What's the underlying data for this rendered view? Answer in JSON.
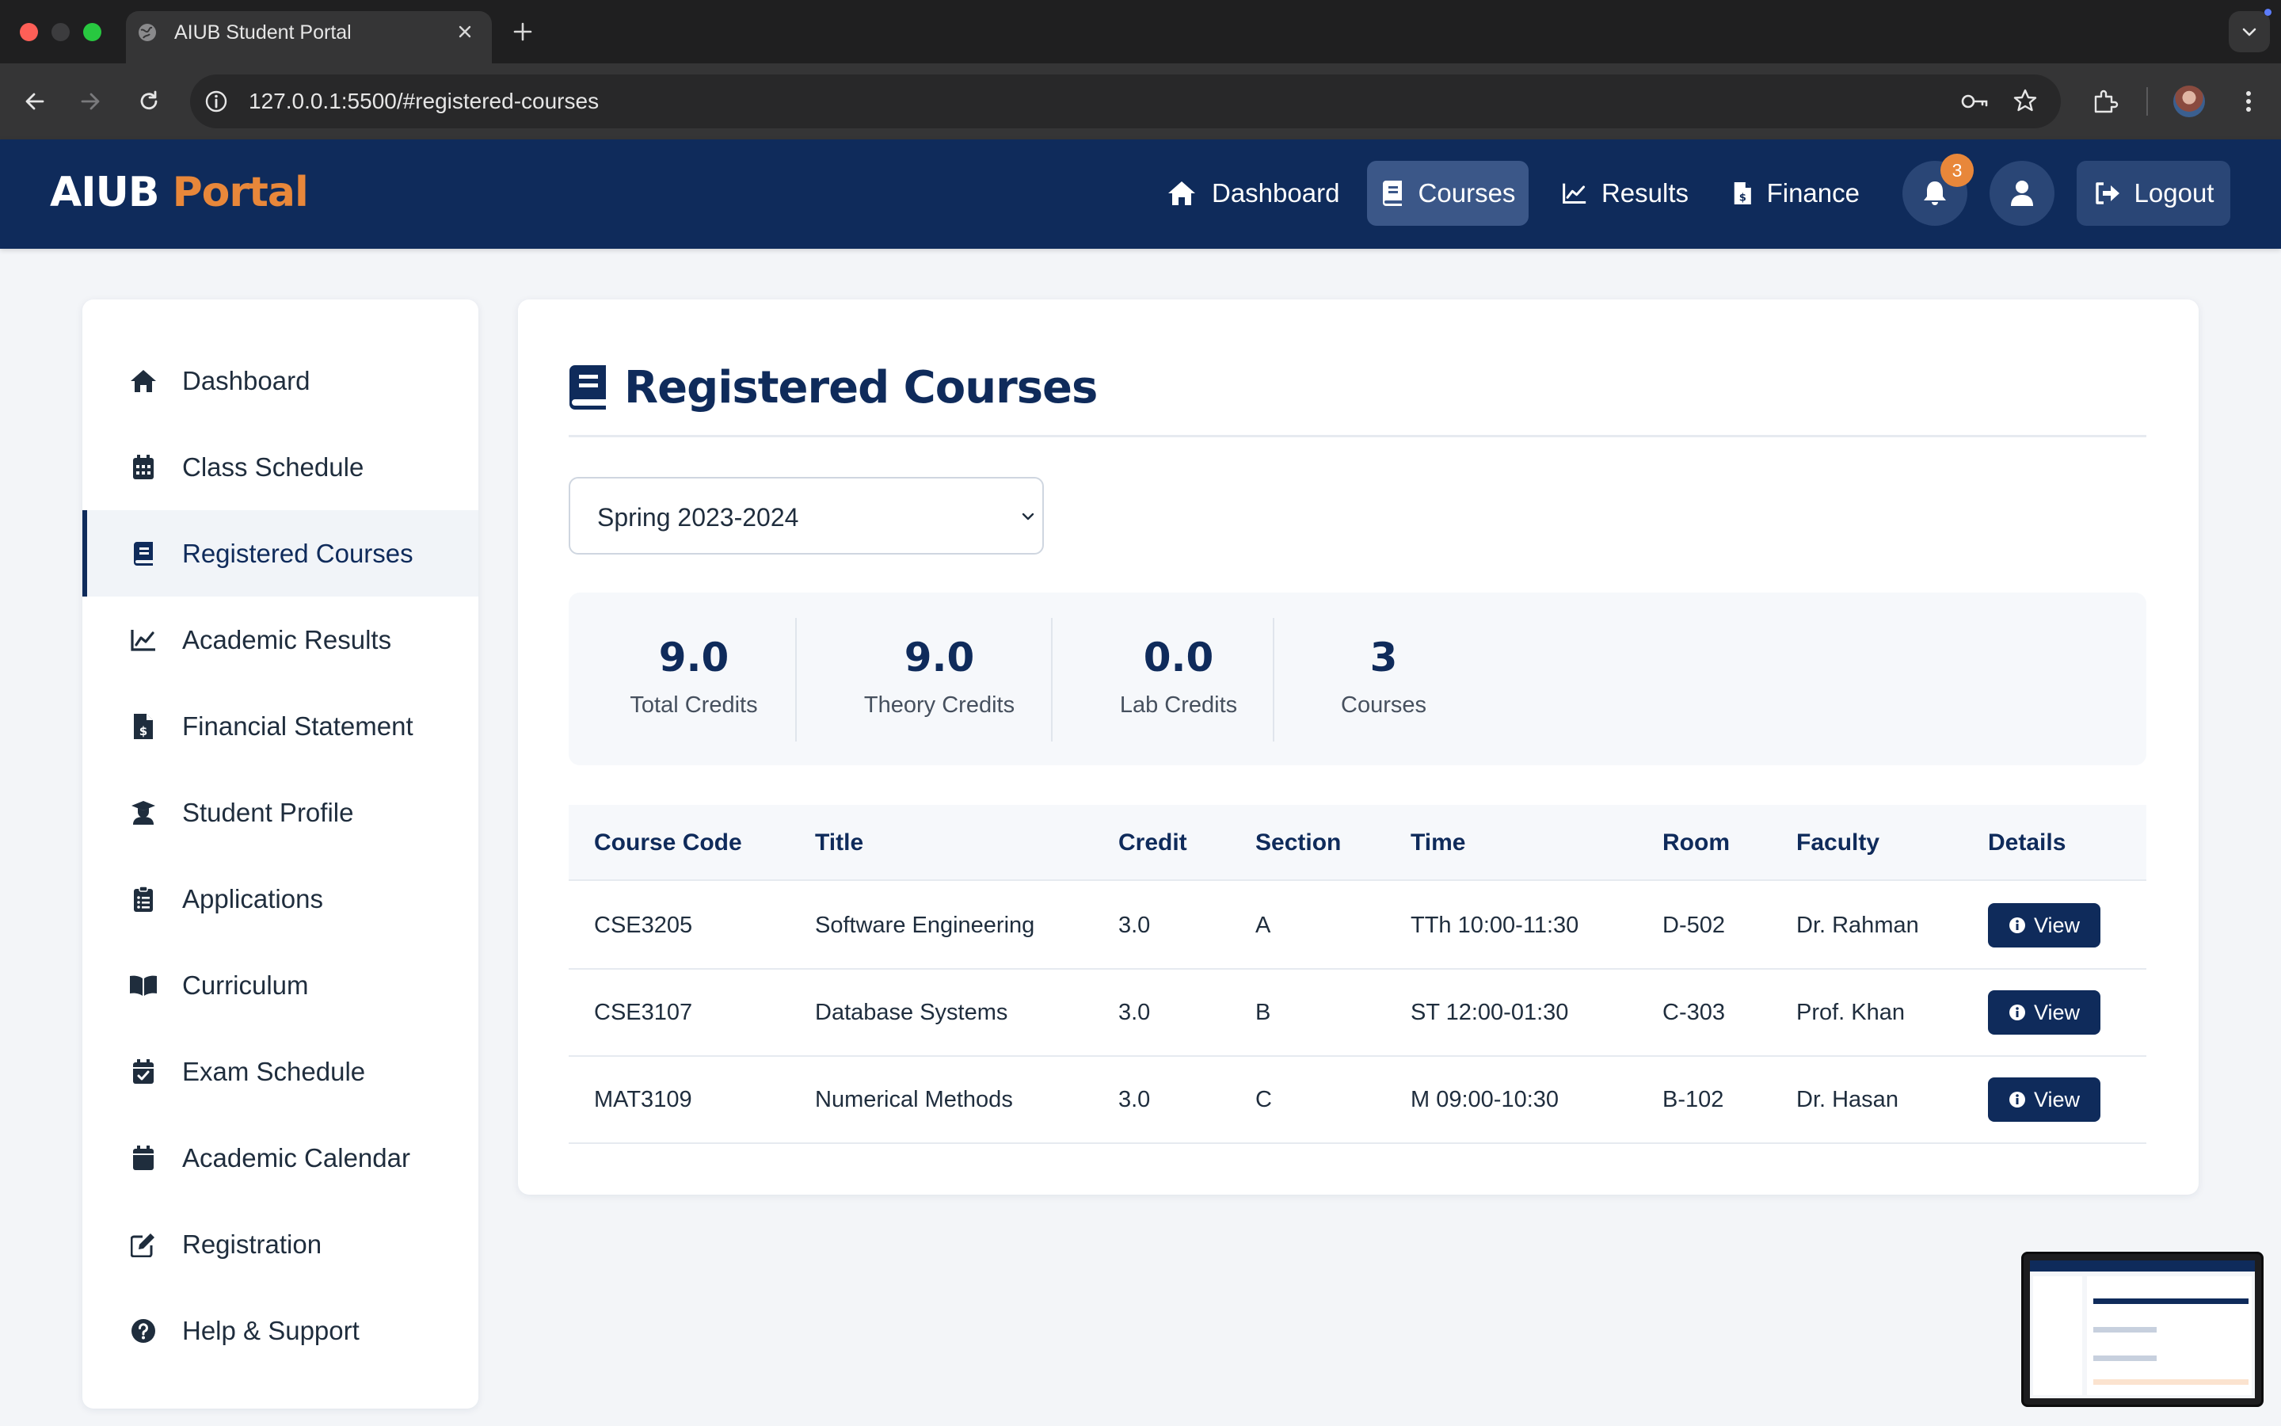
{
  "browser": {
    "tab_title": "AIUB Student Portal",
    "url": "127.0.0.1:5500/#registered-courses"
  },
  "header": {
    "brand_main": "AIUB",
    "brand_accent": "Portal",
    "nav": [
      {
        "label": "Dashboard",
        "icon": "home-icon"
      },
      {
        "label": "Courses",
        "icon": "book-icon",
        "active": true
      },
      {
        "label": "Results",
        "icon": "chart-line-icon"
      },
      {
        "label": "Finance",
        "icon": "invoice-dollar-icon"
      }
    ],
    "notification_count": "3",
    "logout_label": "Logout"
  },
  "sidebar": {
    "items": [
      {
        "label": "Dashboard",
        "icon": "home-icon"
      },
      {
        "label": "Class Schedule",
        "icon": "calendar-grid-icon"
      },
      {
        "label": "Registered Courses",
        "icon": "book-icon",
        "active": true
      },
      {
        "label": "Academic Results",
        "icon": "chart-line-icon"
      },
      {
        "label": "Financial Statement",
        "icon": "invoice-dollar-icon"
      },
      {
        "label": "Student Profile",
        "icon": "graduate-icon"
      },
      {
        "label": "Applications",
        "icon": "clipboard-list-icon"
      },
      {
        "label": "Curriculum",
        "icon": "open-book-icon"
      },
      {
        "label": "Exam Schedule",
        "icon": "calendar-check-icon"
      },
      {
        "label": "Academic Calendar",
        "icon": "calendar-icon"
      },
      {
        "label": "Registration",
        "icon": "edit-icon"
      },
      {
        "label": "Help & Support",
        "icon": "question-circle-icon"
      }
    ]
  },
  "main": {
    "title": "Registered Courses",
    "semester": {
      "selected": "Spring 2023-2024"
    },
    "stats": [
      {
        "value": "9.0",
        "label": "Total Credits"
      },
      {
        "value": "9.0",
        "label": "Theory Credits"
      },
      {
        "value": "0.0",
        "label": "Lab Credits"
      },
      {
        "value": "3",
        "label": "Courses"
      }
    ],
    "table": {
      "headers": [
        "Course Code",
        "Title",
        "Credit",
        "Section",
        "Time",
        "Room",
        "Faculty",
        "Details"
      ],
      "rows": [
        {
          "code": "CSE3205",
          "title": "Software Engineering",
          "credit": "3.0",
          "section": "A",
          "time": "TTh 10:00-11:30",
          "room": "D-502",
          "faculty": "Dr. Rahman",
          "action": "View"
        },
        {
          "code": "CSE3107",
          "title": "Database Systems",
          "credit": "3.0",
          "section": "B",
          "time": "ST 12:00-01:30",
          "room": "C-303",
          "faculty": "Prof. Khan",
          "action": "View"
        },
        {
          "code": "MAT3109",
          "title": "Numerical Methods",
          "credit": "3.0",
          "section": "C",
          "time": "M 09:00-10:30",
          "room": "B-102",
          "faculty": "Dr. Hasan",
          "action": "View"
        }
      ]
    }
  },
  "colors": {
    "primary": "#0f2b5b",
    "accent": "#e8873a",
    "page_bg": "#f3f5f8"
  }
}
